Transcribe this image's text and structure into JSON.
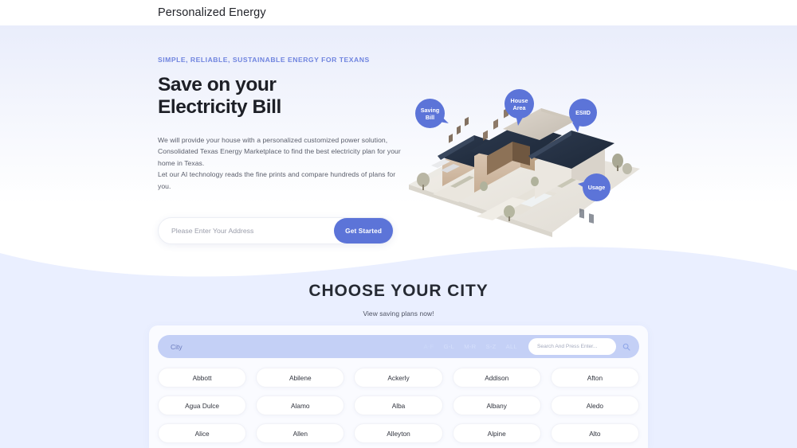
{
  "topbar": {
    "brand": "Personalized Energy"
  },
  "hero": {
    "eyebrow": "SIMPLE, RELIABLE, SUSTAINABLE ENERGY FOR TEXANS",
    "title_line1": "Save on your",
    "title_line2": "Electricity Bill",
    "body_line1": "We will provide your house with a personalized customized power solution, Consolidated Texas Energy Marketplace to find the best electricity plan for your home in Texas.",
    "body_line2": "Let our AI technology reads the fine prints and compare hundreds of plans for you.",
    "address_placeholder": "Please Enter Your Address",
    "address_value": "",
    "cta_label": "Get Started",
    "badges": [
      {
        "id": "saving",
        "line1": "Saving",
        "line2": "Bill"
      },
      {
        "id": "house",
        "line1": "House",
        "line2": "Area"
      },
      {
        "id": "esiid",
        "line1": "ESIID",
        "line2": ""
      },
      {
        "id": "usage",
        "line1": "Usage",
        "line2": ""
      }
    ]
  },
  "city_section": {
    "title": "CHOOSE YOUR CITY",
    "subtitle": "View saving plans now!",
    "filter_label": "City",
    "alpha_filters": [
      "A-F",
      "G-L",
      "M-R",
      "S-Z",
      "ALL"
    ],
    "search_placeholder": "Search And Press Enter...",
    "search_value": "",
    "cities": [
      "Abbott",
      "Abilene",
      "Ackerly",
      "Addison",
      "Afton",
      "Agua Dulce",
      "Alamo",
      "Alba",
      "Albany",
      "Aledo",
      "Alice",
      "Allen",
      "Alleyton",
      "Alpine",
      "Alto"
    ]
  },
  "colors": {
    "accent": "#5c74d8",
    "eyebrow": "#6f84df",
    "section_bg": "#eaefff",
    "filter_bar": "#c4d0f6",
    "panel_bg": "#fafbff"
  }
}
